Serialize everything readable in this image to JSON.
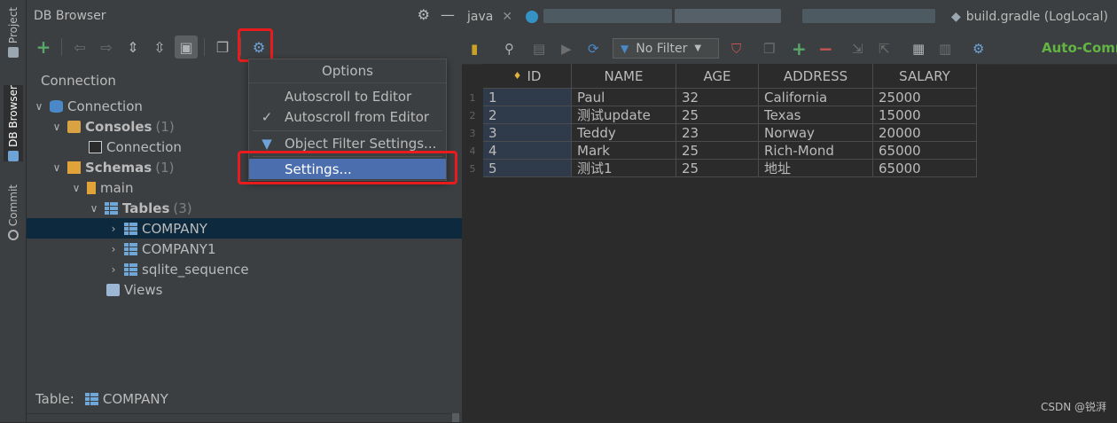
{
  "left_strip": {
    "tabs": [
      {
        "label": "Project",
        "icon": "folder-icon"
      },
      {
        "label": "DB Browser",
        "icon": "database-icon"
      },
      {
        "label": "Commit",
        "icon": "commit-icon"
      }
    ]
  },
  "panel": {
    "title": "DB Browser",
    "header_icons": [
      "gear-icon",
      "minimize-icon"
    ],
    "toolbar": [
      "add-icon",
      "back-icon",
      "forward-icon",
      "expand-all-icon",
      "collapse-all-icon",
      "autoscroll-icon",
      "new-window-icon",
      "settings-gear-icon"
    ],
    "connection_label": "Connection",
    "tree": {
      "connection": "Connection",
      "consoles": {
        "label": "Consoles",
        "count": "(1)"
      },
      "console_item": "Connection",
      "schemas": {
        "label": "Schemas",
        "count": "(1)"
      },
      "main": "main",
      "tables": {
        "label": "Tables",
        "count": "(3)"
      },
      "table_items": [
        "COMPANY",
        "COMPANY1",
        "sqlite_sequence"
      ],
      "views": "Views"
    },
    "footer": {
      "label": "Table:",
      "value": "COMPANY"
    }
  },
  "popup": {
    "title": "Options",
    "items": [
      {
        "label": "Autoscroll to Editor",
        "checked": false
      },
      {
        "label": "Autoscroll from Editor",
        "checked": true
      },
      {
        "label": "Object Filter Settings...",
        "icon": "filter-icon"
      },
      {
        "label": "Settings...",
        "selected": true
      }
    ]
  },
  "editor": {
    "tabs": [
      {
        "label": "java",
        "closable": true
      },
      {
        "label": "build.gradle (LogLocal)",
        "icon": "gradle-icon"
      }
    ],
    "toolbar": {
      "filter_label": "No Filter",
      "autocommit_label": "Auto-Comm"
    },
    "grid": {
      "columns": [
        "ID",
        "NAME",
        "AGE",
        "ADDRESS",
        "SALARY"
      ],
      "rows": [
        [
          "1",
          "Paul",
          "32",
          "California",
          "25000"
        ],
        [
          "2",
          "测试update",
          "25",
          "Texas",
          "15000"
        ],
        [
          "3",
          "Teddy",
          "23",
          "Norway",
          "20000"
        ],
        [
          "4",
          "Mark",
          "25",
          "Rich-Mond",
          "65000"
        ],
        [
          "5",
          "测试1",
          "25",
          "地址",
          "65000"
        ]
      ],
      "row_numbers": [
        "1",
        "2",
        "3",
        "4",
        "5"
      ]
    },
    "watermark": "CSDN @锐湃"
  },
  "colors": {
    "background": "#2b2b2b",
    "panel": "#3c3f41",
    "selection": "#0d293e",
    "menu_selected": "#4b6eaf",
    "highlight_red": "#e81c1c",
    "autocommit_green": "#62b543"
  }
}
